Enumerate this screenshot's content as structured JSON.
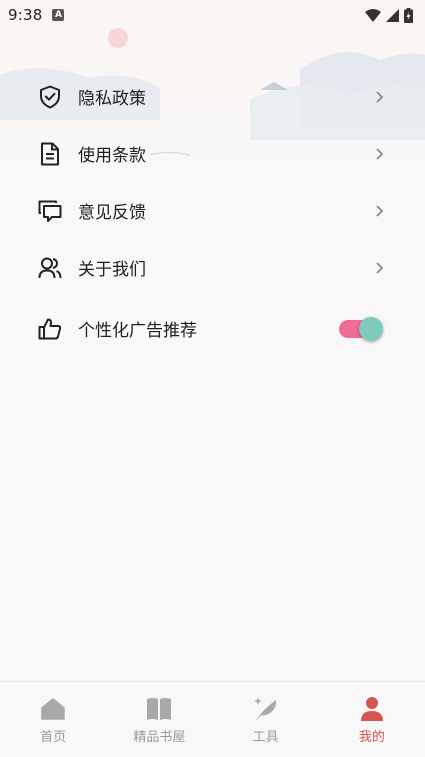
{
  "status_bar": {
    "time": "9:38",
    "notification_icon": "A"
  },
  "menu": {
    "items": [
      {
        "label": "隐私政策",
        "icon": "shield-check-icon"
      },
      {
        "label": "使用条款",
        "icon": "document-icon"
      },
      {
        "label": "意见反馈",
        "icon": "chat-bubbles-icon"
      },
      {
        "label": "关于我们",
        "icon": "users-icon"
      }
    ],
    "toggle_item": {
      "label": "个性化广告推荐",
      "icon": "thumbs-up-icon",
      "enabled": true
    }
  },
  "bottom_nav": {
    "items": [
      {
        "label": "首页",
        "icon": "home-icon"
      },
      {
        "label": "精品书屋",
        "icon": "book-icon"
      },
      {
        "label": "工具",
        "icon": "feather-icon"
      },
      {
        "label": "我的",
        "icon": "person-icon",
        "active": true
      }
    ]
  },
  "colors": {
    "accent": "#d9534f",
    "toggle_track": "#ef6d93",
    "toggle_knob": "#7ecabd",
    "inactive": "#9a9a9a"
  }
}
